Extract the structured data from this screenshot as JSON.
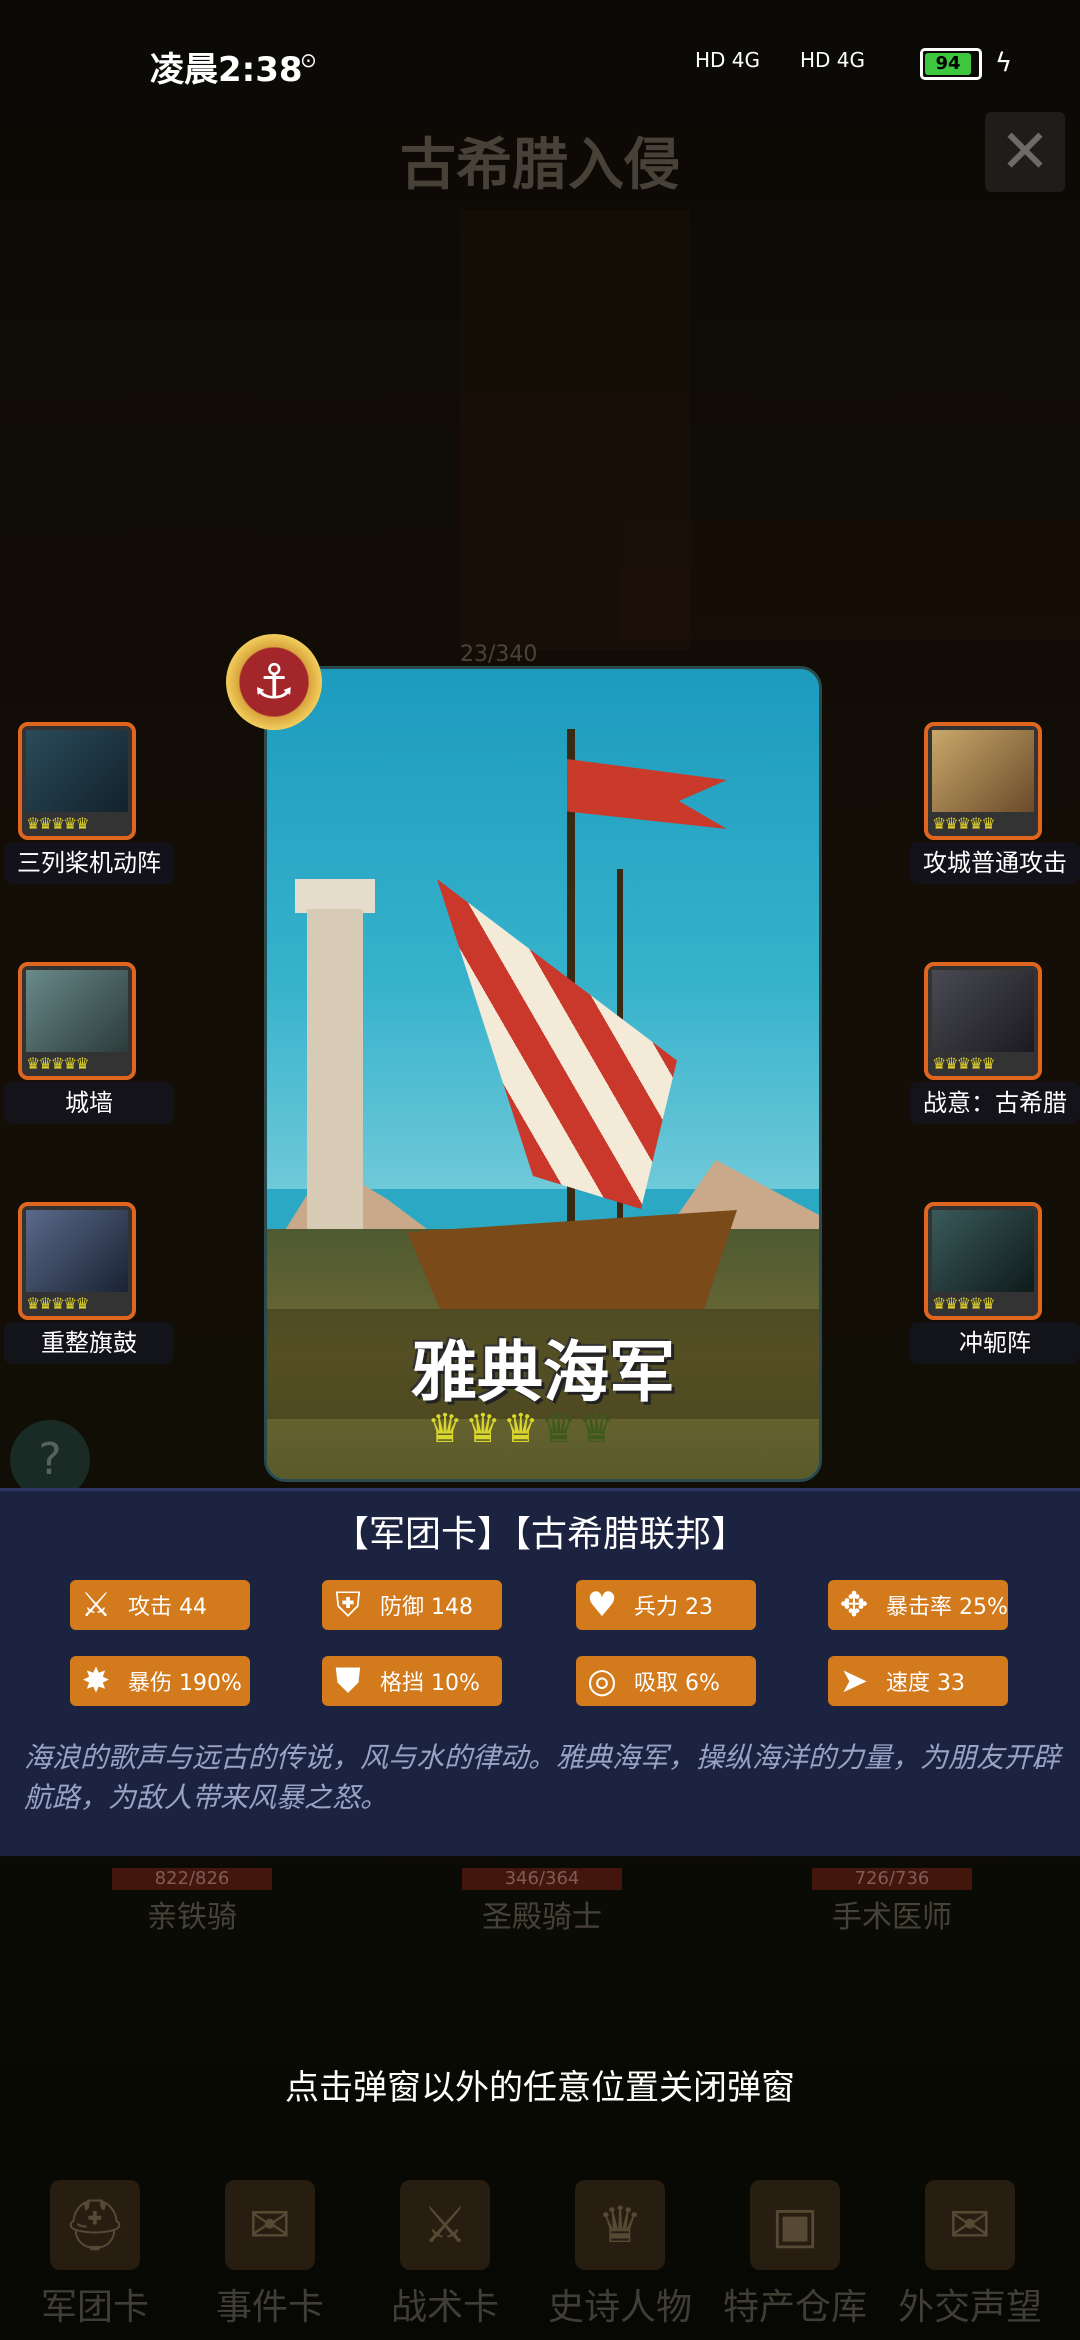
{
  "status_bar": {
    "time": "凌晨2:38",
    "network1": "HD 4G",
    "network2": "HD 4G",
    "battery": "94"
  },
  "header": {
    "title": "古希腊入侵",
    "close_icon": "close-icon"
  },
  "card": {
    "name": "雅典海军",
    "stars_on": 3,
    "stars_total": 5,
    "badge_icon": "anchor-icon"
  },
  "skills_left": [
    {
      "label": "三列桨机动阵",
      "icon": "ship-icon"
    },
    {
      "label": "城墙",
      "icon": "wall-icon"
    },
    {
      "label": "重整旗鼓",
      "icon": "knight-icon"
    }
  ],
  "skills_right": [
    {
      "label": "攻城普通攻击",
      "icon": "fire-icon"
    },
    {
      "label": "战意：古希腊",
      "icon": "sword-icon"
    },
    {
      "label": "冲轭阵",
      "icon": "warrior-icon"
    }
  ],
  "info": {
    "tags": "【军团卡】【古希腊联邦】",
    "stats": [
      {
        "label": "攻击 44",
        "icon": "attack-icon"
      },
      {
        "label": "防御 148",
        "icon": "defense-icon"
      },
      {
        "label": "兵力 23",
        "icon": "heart-icon"
      },
      {
        "label": "暴击率 25%",
        "icon": "crit-icon"
      },
      {
        "label": "暴伤 190%",
        "icon": "crit-damage-icon"
      },
      {
        "label": "格挡 10%",
        "icon": "block-icon"
      },
      {
        "label": "吸取 6%",
        "icon": "lifesteal-icon"
      },
      {
        "label": "速度 33",
        "icon": "speed-icon"
      }
    ],
    "description": "海浪的歌声与远古的传说，风与水的律动。雅典海军，操纵海洋的力量，为朋友开辟航路，为敌人带来风暴之怒。"
  },
  "background": {
    "top_counter": "23/340",
    "units": [
      {
        "name": "亲铁骑",
        "hp": "822/826"
      },
      {
        "name": "圣殿骑士",
        "hp": "346/364"
      },
      {
        "name": "手术医师",
        "hp": "726/736"
      }
    ]
  },
  "hint": "点击弹窗以外的任意位置关闭弹窗",
  "bottom_nav": [
    {
      "label": "军团卡",
      "icon": "helmet-icon"
    },
    {
      "label": "事件卡",
      "icon": "scroll-icon"
    },
    {
      "label": "战术卡",
      "icon": "crossed-swords-icon"
    },
    {
      "label": "史诗人物",
      "icon": "crown-icon"
    },
    {
      "label": "特产仓库",
      "icon": "chest-icon"
    },
    {
      "label": "外交声望",
      "icon": "letter-icon"
    }
  ]
}
